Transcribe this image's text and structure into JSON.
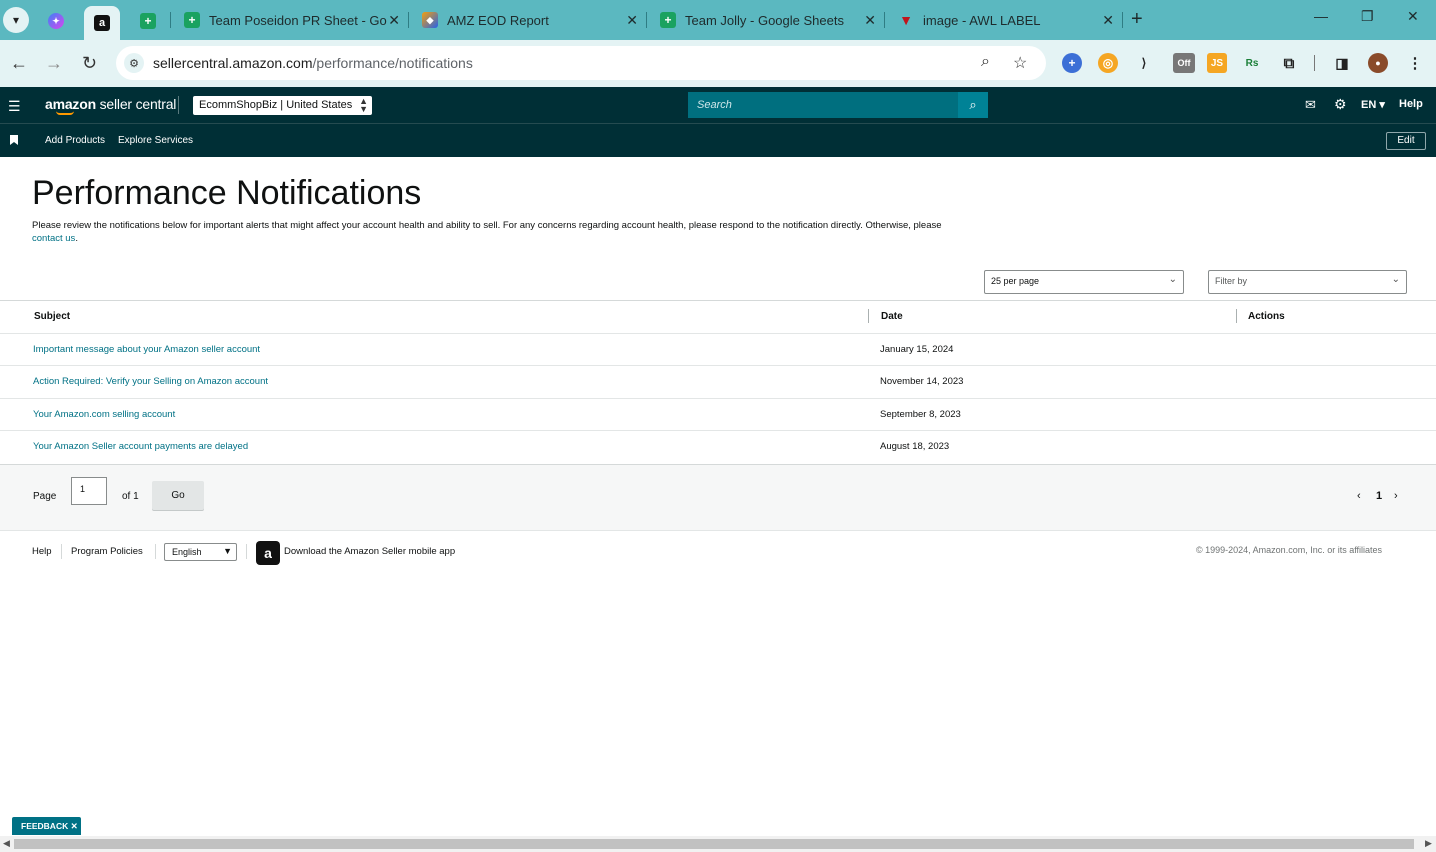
{
  "browser": {
    "tabs": [
      {
        "title": "Team Poseidon PR Sheet - Goo"
      },
      {
        "title": "AMZ EOD Report"
      },
      {
        "title": "Team Jolly - Google Sheets"
      },
      {
        "title": "image - AWL LABEL"
      }
    ],
    "url_host": "sellercentral.amazon.com",
    "url_path": "/performance/notifications",
    "extensions": [
      "+",
      "◎",
      "⟩",
      "Off",
      "JS",
      "Rs"
    ]
  },
  "header": {
    "logo_main": "amazon",
    "logo_suffix": " seller central",
    "account": "EcommShopBiz | United States",
    "search_placeholder": "Search",
    "lang": "EN",
    "help": "Help"
  },
  "subnav": {
    "items": [
      "Add Products",
      "Explore Services"
    ],
    "edit": "Edit"
  },
  "page": {
    "title": "Performance Notifications",
    "intro": "Please review the notifications below for important alerts that might affect your account health and ability to sell. For any concerns regarding account health, please respond to the notification directly. Otherwise, please ",
    "intro_link": "contact us",
    "intro_end": ".",
    "per_page": "25 per page",
    "filter": "Filter by"
  },
  "table": {
    "headers": [
      "Subject",
      "Date",
      "Actions"
    ],
    "rows": [
      {
        "subject": "Important message about your Amazon seller account",
        "date": "January 15, 2024"
      },
      {
        "subject": "Action Required: Verify your Selling on Amazon account",
        "date": "November 14, 2023"
      },
      {
        "subject": "Your Amazon.com selling account",
        "date": "September 8, 2023"
      },
      {
        "subject": "Your Amazon Seller account payments are delayed",
        "date": "August 18, 2023"
      }
    ]
  },
  "pager": {
    "page_label": "Page",
    "page_value": "1",
    "of_label": "of 1",
    "go": "Go",
    "current": "1"
  },
  "footer": {
    "help": "Help",
    "policies": "Program Policies",
    "language": "English",
    "app_text": "Download the Amazon Seller mobile app",
    "copyright": "© 1999-2024, Amazon.com, Inc. or its affiliates"
  },
  "feedback": "FEEDBACK ✕",
  "colors": {
    "tabbar": "#5bb8c0",
    "header": "#002f36",
    "link": "#007185",
    "search_btn": "#008296"
  }
}
